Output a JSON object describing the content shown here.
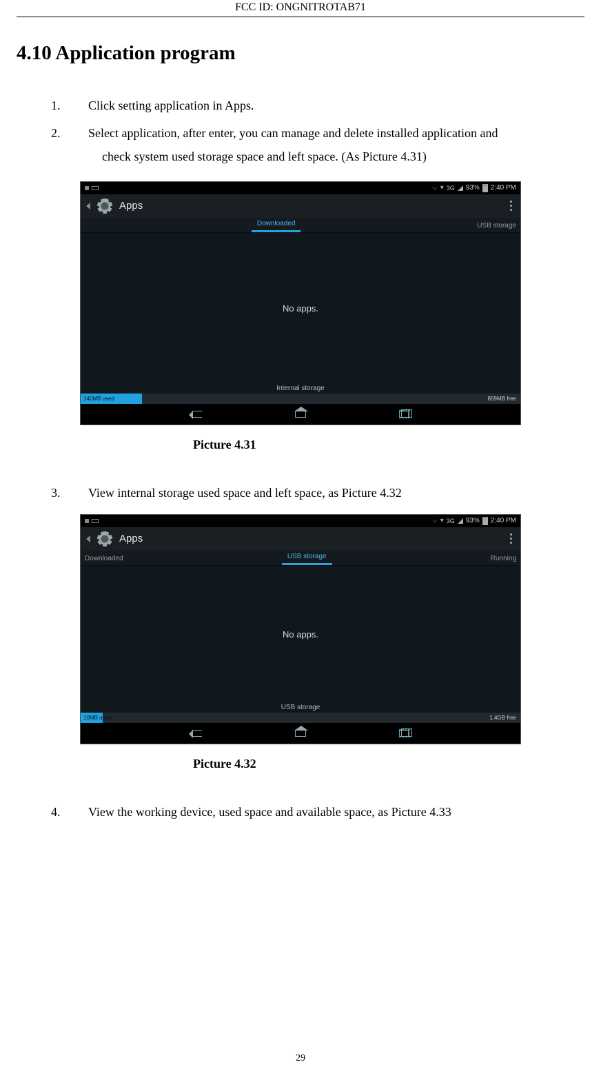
{
  "header": {
    "fcc_id": "FCC ID: ONGNITROTAB71"
  },
  "page_number": "29",
  "section": {
    "heading": "4.10 Application program"
  },
  "list": {
    "i1": {
      "num": "1.",
      "text": "Click setting application in Apps."
    },
    "i2": {
      "num": "2.",
      "line1": "Select application, after enter, you can manage and delete installed application and",
      "line2": "check system used storage space and left space. (As Picture 4.31)"
    },
    "i3": {
      "num": "3.",
      "text": "View internal storage used space and left space, as Picture 4.32"
    },
    "i4": {
      "num": "4.",
      "text": "View the working device, used space and available space, as Picture 4.33"
    }
  },
  "captions": {
    "c1": "Picture 4.31",
    "c2": "Picture 4.32"
  },
  "shot1": {
    "status": {
      "net_label": "3G",
      "battery_pct": "93%",
      "time": "2:40 PM"
    },
    "title": "Apps",
    "tabs": {
      "active": "Downloaded",
      "right": "USB storage"
    },
    "body_msg": "No apps.",
    "storage_label": "Internal storage",
    "used_text": "140MB used",
    "used_pct": 14,
    "free_text": "859MB free"
  },
  "shot2": {
    "status": {
      "net_label": "3G",
      "battery_pct": "93%",
      "time": "2:40 PM"
    },
    "title": "Apps",
    "tabs": {
      "left": "Downloaded",
      "active": "USB storage",
      "right": "Running"
    },
    "body_msg": "No apps.",
    "storage_label": "USB storage",
    "used_text": "10MB used",
    "used_pct": 5,
    "free_text": "1.4GB free"
  }
}
